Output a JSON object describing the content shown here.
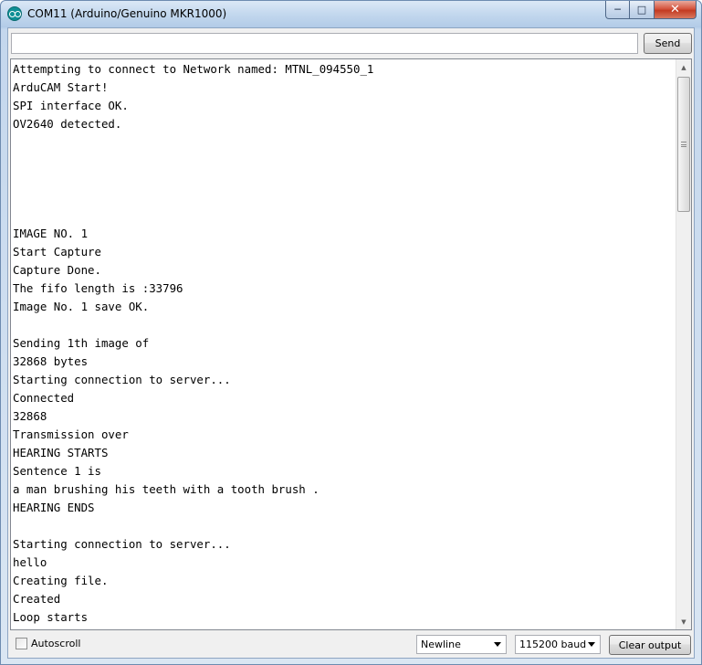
{
  "window": {
    "title": "COM11 (Arduino/Genuino MKR1000)",
    "controls": {
      "minimize": "─",
      "maximize": "□",
      "close": "✕"
    }
  },
  "toolbar": {
    "input_value": "",
    "send_label": "Send"
  },
  "console": {
    "lines": [
      "Attempting to connect to Network named: MTNL_094550_1",
      "ArduCAM Start!",
      "SPI interface OK.",
      "OV2640 detected.",
      "",
      "",
      "",
      "",
      "",
      "IMAGE NO. 1",
      "Start Capture",
      "Capture Done.",
      "The fifo length is :33796",
      "Image No. 1 save OK.",
      "",
      "Sending 1th image of",
      "32868 bytes",
      "Starting connection to server...",
      "Connected",
      "32868",
      "Transmission over",
      "HEARING STARTS",
      "Sentence 1 is",
      "a man brushing his teeth with a tooth brush .",
      "HEARING ENDS",
      "",
      "Starting connection to server...",
      "hello",
      "Creating file.",
      "Created",
      "Loop starts"
    ]
  },
  "footer": {
    "autoscroll_label": "Autoscroll",
    "autoscroll_checked": false,
    "line_ending": "Newline",
    "baud_rate": "115200 baud",
    "clear_label": "Clear output"
  },
  "colors": {
    "title_bar": "#c3d8ee",
    "close_button": "#c33b22",
    "app_icon": "#0f8f95"
  }
}
